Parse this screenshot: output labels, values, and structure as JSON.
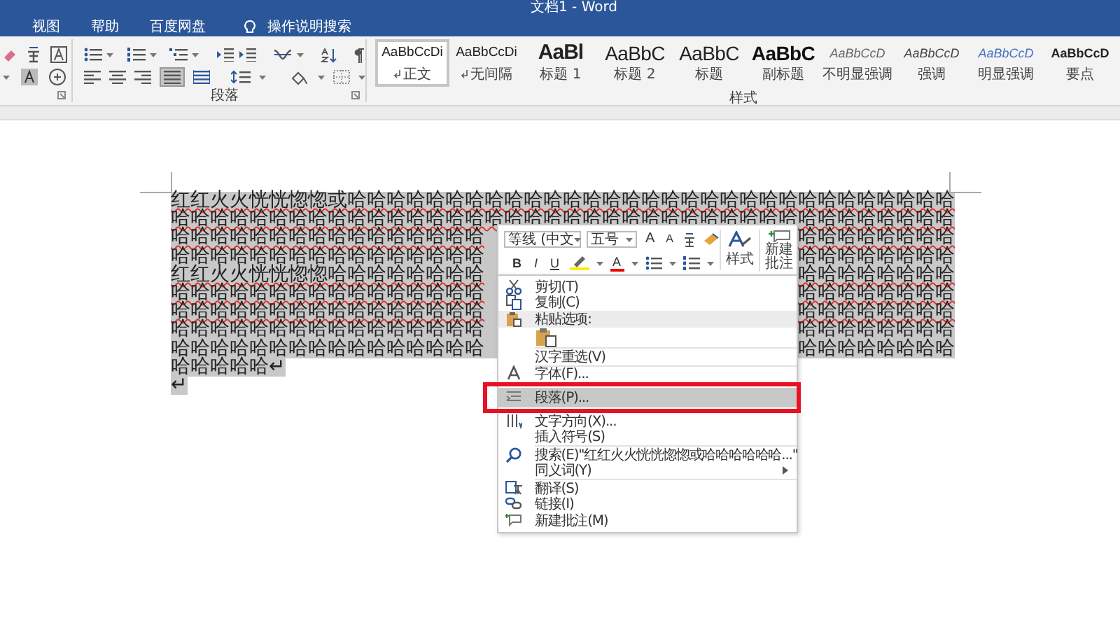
{
  "window": {
    "title": "文档1 - Word"
  },
  "tabs": [
    {
      "label": "视图",
      "selected": false
    },
    {
      "label": "帮助",
      "selected": false
    },
    {
      "label": "百度网盘",
      "selected": false
    }
  ],
  "tell_me": {
    "label": "操作说明搜索"
  },
  "ribbon": {
    "groups": [
      {
        "label": "段落"
      },
      {
        "label": "样式"
      }
    ],
    "styles": [
      {
        "sample": "AaBbCcDi",
        "label": "正文",
        "kind": "normal",
        "selected": true
      },
      {
        "sample": "AaBbCcDi",
        "label": "无间隔",
        "kind": "normal",
        "selected": false
      },
      {
        "sample": "AaBl",
        "label": "标题 1",
        "kind": "heading1",
        "selected": false
      },
      {
        "sample": "AaBbC",
        "label": "标题 2",
        "kind": "heading2",
        "selected": false
      },
      {
        "sample": "AaBbC",
        "label": "标题",
        "kind": "title",
        "selected": false
      },
      {
        "sample": "AaBbC",
        "label": "副标题",
        "kind": "subtitle",
        "selected": false
      },
      {
        "sample": "AaBbCcD",
        "label": "不明显强调",
        "kind": "subtle",
        "selected": false
      },
      {
        "sample": "AaBbCcD",
        "label": "强调",
        "kind": "emphasis",
        "selected": false
      },
      {
        "sample": "AaBbCcD",
        "label": "明显强调",
        "kind": "intense",
        "selected": false
      },
      {
        "sample": "AaBbCcD",
        "label": "要点",
        "kind": "strong",
        "selected": false
      }
    ]
  },
  "document": {
    "lines": [
      {
        "segments": [
          "红红火火恍恍惚惚或哈哈哈哈哈哈哈哈哈哈哈哈哈哈哈哈哈哈哈哈哈哈哈哈哈哈哈哈哈哈哈"
        ],
        "selected": true,
        "flagged": true
      },
      {
        "segments": [
          "哈哈哈哈哈哈哈哈哈哈哈哈哈哈哈哈哈哈哈哈哈哈哈哈哈哈哈哈哈哈哈哈哈哈哈哈哈哈哈哈"
        ],
        "selected": true,
        "flagged": true
      },
      {
        "segments": [
          "哈哈哈哈哈哈哈哈哈哈哈哈哈哈哈哈",
          "哈哈哈哈哈哈哈哈"
        ],
        "selected": true,
        "flagged": true
      },
      {
        "segments": [
          "哈哈哈哈哈哈哈哈哈哈哈哈哈哈哈哈",
          "哈哈哈哈哈哈哈哈"
        ],
        "selected": true,
        "flagged": false
      },
      {
        "segments": [
          "红红火火恍恍惚惚哈哈哈哈哈哈哈哈",
          "哈哈哈哈哈哈哈哈"
        ],
        "selected": true,
        "flagged": true
      },
      {
        "segments": [
          "哈哈哈哈哈哈哈哈哈哈哈哈哈哈哈哈",
          "哈哈哈哈哈哈哈哈"
        ],
        "selected": true,
        "flagged": true
      },
      {
        "segments": [
          "哈哈哈哈哈哈哈哈哈哈哈哈哈哈哈哈",
          "哈哈哈哈哈哈哈哈"
        ],
        "selected": true,
        "flagged": true
      },
      {
        "segments": [
          "哈哈哈哈哈哈哈哈哈哈哈哈哈哈哈哈",
          "哈哈哈哈哈哈哈哈"
        ],
        "selected": true,
        "flagged": false
      },
      {
        "segments": [
          "哈哈哈哈哈哈哈哈哈哈哈哈哈哈哈哈",
          "哈哈哈哈哈哈哈哈"
        ],
        "selected": true,
        "flagged": false
      },
      {
        "segments": [
          "哈哈哈哈哈↵"
        ],
        "selected": true,
        "flagged": false
      },
      {
        "segments": [
          "↵"
        ],
        "selected": true,
        "flagged": false
      }
    ]
  },
  "mini_toolbar": {
    "font": "等线 (中文",
    "size": "五号",
    "grow": "A",
    "shrink": "A",
    "bold": "B",
    "italic": "I",
    "underline": "U",
    "font_color": "A",
    "styles": "样式",
    "new_comment": "新建批注"
  },
  "context_menu": {
    "items": [
      {
        "kind": "cut",
        "label": "剪切(T)",
        "selected": false,
        "framed": false
      },
      {
        "kind": "copy",
        "label": "复制(C)",
        "selected": false,
        "framed": false
      },
      {
        "kind": "paste-header",
        "label": "粘贴选项:"
      },
      {
        "kind": "paste-keep",
        "selected": false
      },
      {
        "kind": "reselect",
        "label": "汉字重选(V)",
        "selected": false,
        "framed": false
      },
      {
        "kind": "font",
        "label": "字体(F)...",
        "selected": false,
        "framed": false
      },
      {
        "kind": "paragraph",
        "label": "段落(P)...",
        "selected": true,
        "framed": true
      },
      {
        "kind": "direction",
        "label": "文字方向(X)...",
        "selected": false,
        "framed": false
      },
      {
        "kind": "symbol",
        "label": "插入符号(S)",
        "selected": false,
        "framed": false
      },
      {
        "kind": "search",
        "label": "搜索(E)\"红红火火恍恍惚惚或哈哈哈哈哈哈...\"",
        "selected": false,
        "framed": false
      },
      {
        "kind": "synonym",
        "label": "同义词(Y)",
        "selected": false,
        "framed": false
      },
      {
        "kind": "translate",
        "label": "翻译(S)",
        "selected": false,
        "framed": false
      },
      {
        "kind": "link",
        "label": "链接(I)",
        "selected": false,
        "framed": false
      },
      {
        "kind": "comment",
        "label": "新建批注(M)",
        "selected": false,
        "framed": false
      }
    ]
  }
}
